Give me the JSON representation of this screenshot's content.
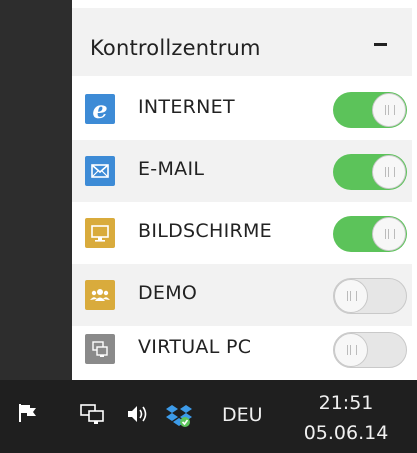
{
  "panel": {
    "title": "Kontrollzentrum",
    "items": [
      {
        "label": "INTERNET",
        "icon": "internet-explorer-icon",
        "icon_color": "#3d8bd6",
        "enabled": true
      },
      {
        "label": "E-MAIL",
        "icon": "mail-icon",
        "icon_color": "#3d8bd6",
        "enabled": true
      },
      {
        "label": "BILDSCHIRME",
        "icon": "monitor-icon",
        "icon_color": "#d9ab3c",
        "enabled": true
      },
      {
        "label": "DEMO",
        "icon": "users-icon",
        "icon_color": "#d9ab3c",
        "enabled": false
      },
      {
        "label": "VIRTUAL PC",
        "icon": "virtual-pc-icon",
        "icon_color": "#8a8a8a",
        "enabled": false
      }
    ]
  },
  "colors": {
    "toggle_on": "#5cc35a",
    "toggle_off": "#e6e6e6",
    "taskbar": "#1f1f1f"
  },
  "taskbar": {
    "icons": [
      "flag-icon",
      "network-icon",
      "speaker-icon",
      "dropbox-icon"
    ],
    "language": "DEU",
    "time": "21:51",
    "date": "05.06.14"
  }
}
